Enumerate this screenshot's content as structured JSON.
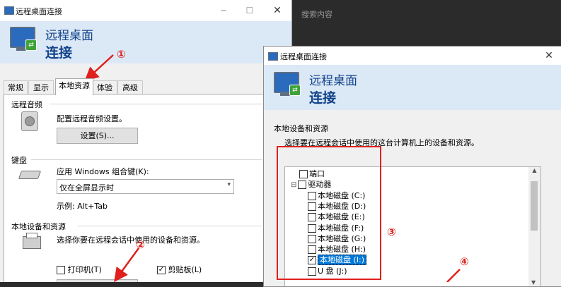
{
  "background": {
    "search_text": "搜索内容"
  },
  "window1": {
    "title": "远程桌面连接",
    "header": {
      "line1": "远程桌面",
      "line2": "连接"
    },
    "tabs": [
      "常规",
      "显示",
      "本地资源",
      "体验",
      "高级"
    ],
    "active_tab": "本地资源",
    "groups": {
      "audio": {
        "title": "远程音频",
        "description": "配置远程音频设置。",
        "button": "设置(S)..."
      },
      "keyboard": {
        "title": "键盘",
        "description": "应用 Windows 组合键(K):",
        "combo_value": "仅在全屏显示时",
        "example": "示例: Alt+Tab"
      },
      "local_devices": {
        "title": "本地设备和资源",
        "description": "选择你要在远程会话中使用的设备和资源。",
        "printers": "打印机(T)",
        "clipboard": "剪贴板(L)",
        "printers_checked": false,
        "clipboard_checked": true
      }
    }
  },
  "window2": {
    "title": "远程桌面连接",
    "header": {
      "line1": "远程桌面",
      "line2": "连接"
    },
    "section_title": "本地设备和资源",
    "section_description": "选择要在远程会话中使用的这台计算机上的设备和资源。",
    "tree": [
      {
        "label": "端口",
        "checked": false,
        "expander": "",
        "indent": 1
      },
      {
        "label": "驱动器",
        "checked": false,
        "expander": "⊟",
        "indent": 0
      },
      {
        "label": "本地磁盘 (C:)",
        "checked": false,
        "indent": 2
      },
      {
        "label": "本地磁盘 (D:)",
        "checked": false,
        "indent": 2
      },
      {
        "label": "本地磁盘 (E:)",
        "checked": false,
        "indent": 2
      },
      {
        "label": "本地磁盘 (F:)",
        "checked": false,
        "indent": 2
      },
      {
        "label": "本地磁盘 (G:)",
        "checked": false,
        "indent": 2
      },
      {
        "label": "本地磁盘 (H:)",
        "checked": false,
        "indent": 2
      },
      {
        "label": "本地磁盘 (I:)",
        "checked": true,
        "selected": true,
        "indent": 2
      },
      {
        "label": "U 盘 (J:)",
        "checked": false,
        "indent": 2
      }
    ]
  },
  "annotations": [
    "①",
    "②",
    "③",
    "④"
  ],
  "colors": {
    "annotation": "#e0201c",
    "header_bg": "#dbe8f6",
    "title_blue": "#10428a",
    "selection": "#0078d7"
  },
  "icons": [
    "remote-desktop-icon",
    "speaker-icon",
    "keyboard-icon",
    "printer-icon",
    "close-icon",
    "minimize-icon",
    "maximize-icon"
  ]
}
